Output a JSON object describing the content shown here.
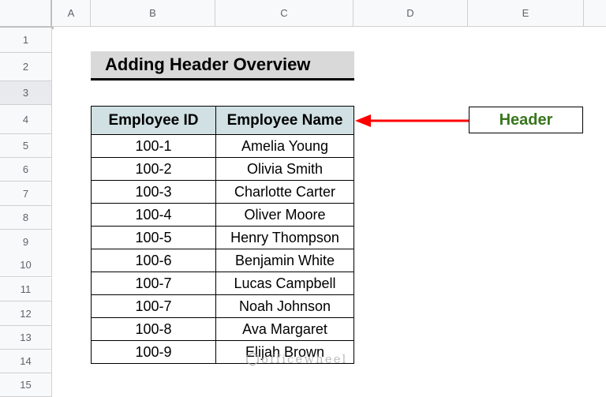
{
  "columns": [
    "A",
    "B",
    "C",
    "D",
    "E",
    ""
  ],
  "rows": [
    "1",
    "2",
    "3",
    "4",
    "5",
    "6",
    "7",
    "8",
    "9",
    "10",
    "11",
    "12",
    "13",
    "14",
    "15"
  ],
  "selected_row": "3",
  "title": "Adding Header Overview",
  "table": {
    "headers": [
      "Employee ID",
      "Employee Name"
    ],
    "rows": [
      [
        "100-1",
        "Amelia Young"
      ],
      [
        "100-2",
        "Olivia Smith"
      ],
      [
        "100-3",
        "Charlotte Carter"
      ],
      [
        "100-4",
        "Oliver Moore"
      ],
      [
        "100-5",
        "Henry Thompson"
      ],
      [
        "100-6",
        "Benjamin White"
      ],
      [
        "100-7",
        "Lucas Campbell"
      ],
      [
        "100-7",
        "Noah Johnson"
      ],
      [
        "100-8",
        "Ava Margaret"
      ],
      [
        "100-9",
        "Elijah Brown"
      ]
    ]
  },
  "annotation": {
    "label": "Header",
    "label_color": "#38761d",
    "arrow_color": "#ff0000"
  },
  "header_fill": "#d0e0e3",
  "watermark": "officewheel"
}
